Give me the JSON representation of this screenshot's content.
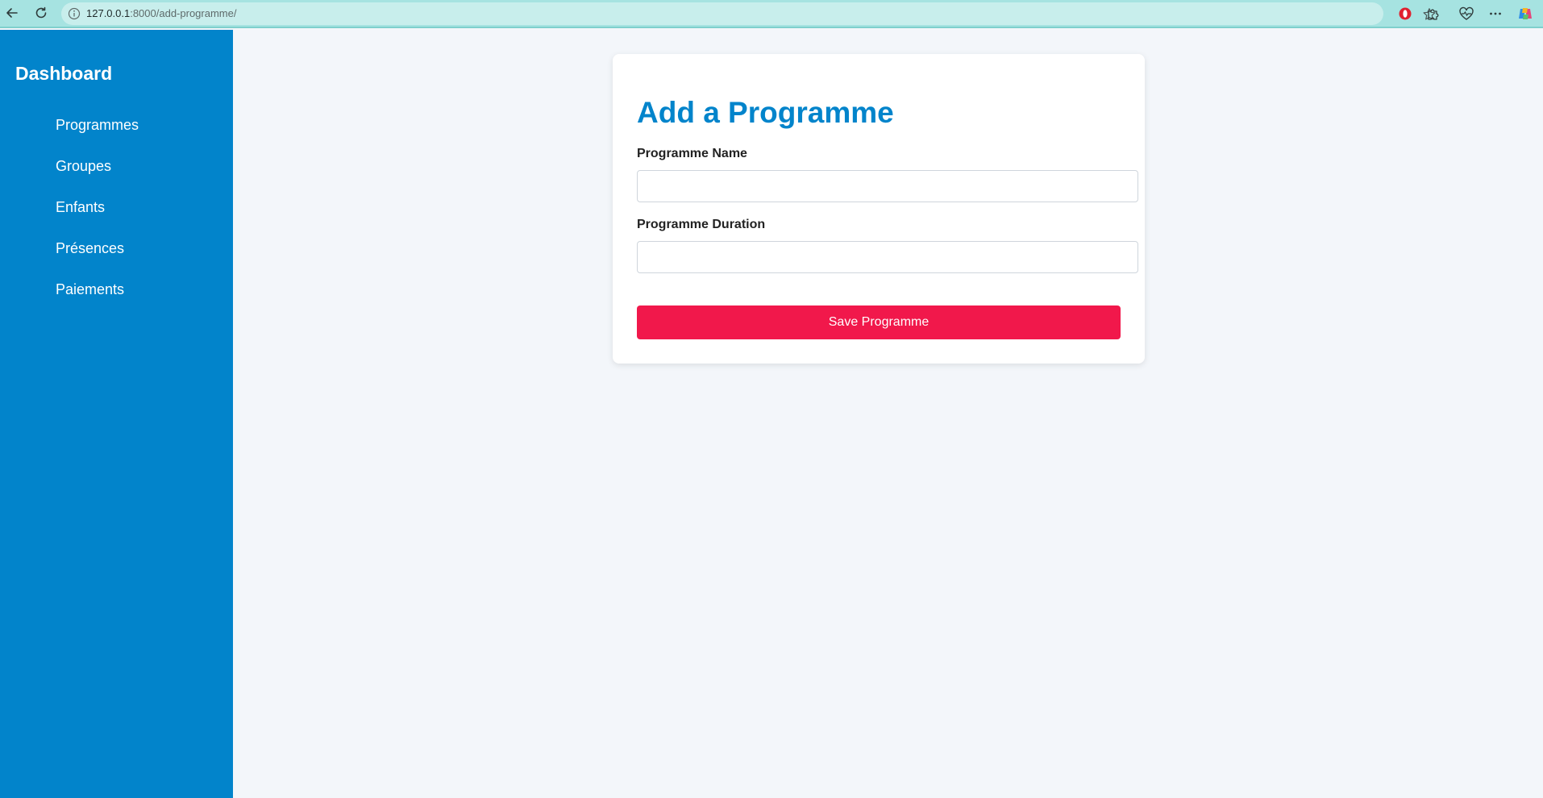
{
  "browser": {
    "url_host": "127.0.0.1",
    "url_rest": ":8000/add-programme/"
  },
  "sidebar": {
    "title": "Dashboard",
    "items": [
      {
        "label": "Programmes"
      },
      {
        "label": "Groupes"
      },
      {
        "label": "Enfants"
      },
      {
        "label": "Présences"
      },
      {
        "label": "Paiements"
      }
    ]
  },
  "form": {
    "title": "Add a Programme",
    "name_label": "Programme Name",
    "name_value": "",
    "duration_label": "Programme Duration",
    "duration_value": "",
    "save_label": "Save Programme"
  },
  "colors": {
    "sidebar_bg": "#0284cb",
    "accent": "#0284cb",
    "save_button": "#f1184b",
    "page_bg": "#f3f6fa",
    "browser_chrome": "#a6e3e1"
  },
  "icons": {
    "back": "arrow-left-icon",
    "reload": "reload-icon",
    "site_info": "info-icon",
    "favorite": "star-icon",
    "extension_1": "opera-icon",
    "extension_2": "puzzle-icon",
    "extension_3": "heart-pulse-icon",
    "menu": "more-icon",
    "copilot": "copilot-icon"
  }
}
